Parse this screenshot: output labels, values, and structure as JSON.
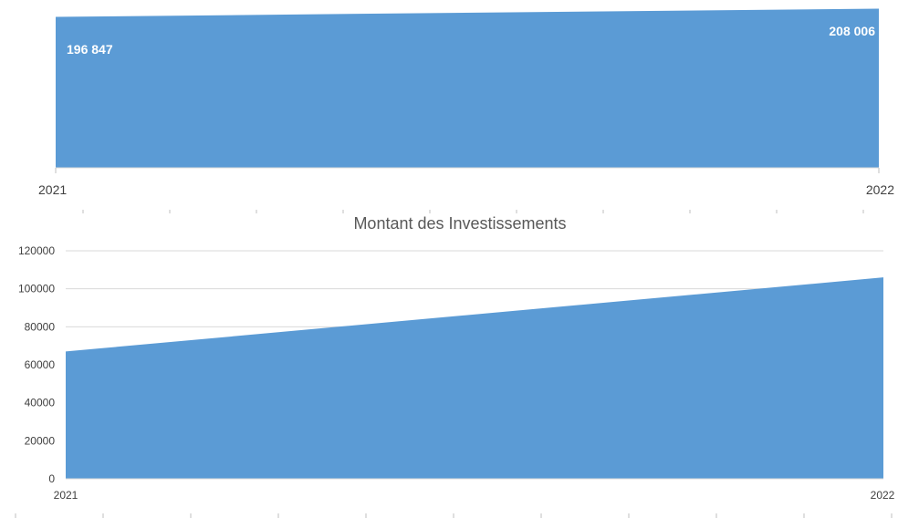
{
  "chart_data": [
    {
      "type": "area",
      "title": "",
      "xlabel": "",
      "ylabel": "",
      "categories": [
        "2021",
        "2022"
      ],
      "series": [
        {
          "values": [
            196847,
            208006
          ]
        }
      ],
      "data_labels": [
        "196 847",
        "208 006"
      ],
      "color": "#5b9bd5",
      "grid": false,
      "legend": "none"
    },
    {
      "type": "area",
      "title": "Montant des Investissements",
      "xlabel": "",
      "ylabel": "",
      "categories": [
        "2021",
        "2022"
      ],
      "series": [
        {
          "values": [
            67000,
            106000
          ]
        }
      ],
      "ylim": [
        0,
        120000
      ],
      "yticks": [
        "0",
        "20000",
        "40000",
        "60000",
        "80000",
        "100000",
        "120000"
      ],
      "color": "#5b9bd5",
      "grid": true,
      "legend": "none"
    }
  ]
}
